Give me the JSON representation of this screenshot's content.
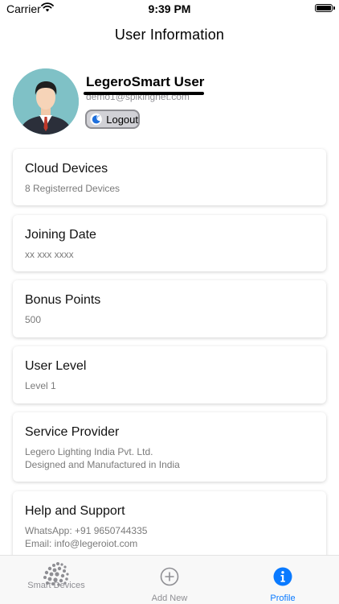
{
  "status_bar": {
    "carrier": "Carrier",
    "time": "9:39 PM"
  },
  "nav": {
    "title": "User Information"
  },
  "profile": {
    "name": "LegeroSmart User",
    "email": "demo1@spikingnet.com",
    "logout_label": "Logout"
  },
  "cards": [
    {
      "title": "Cloud Devices",
      "lines": [
        "8 Registerred Devices"
      ]
    },
    {
      "title": "Joining Date",
      "lines": [
        "xx xxx xxxx"
      ]
    },
    {
      "title": "Bonus Points",
      "lines": [
        "500"
      ]
    },
    {
      "title": "User Level",
      "lines": [
        "Level 1"
      ]
    },
    {
      "title": "Service Provider",
      "lines": [
        "Legero Lighting India Pvt. Ltd.",
        "Designed and Manufactured in India"
      ]
    },
    {
      "title": "Help and Support",
      "lines": [
        "WhatsApp: +91 9650744335",
        "Email: info@legeroiot.com"
      ]
    }
  ],
  "tabs": [
    {
      "label": "Smart Devices",
      "icon": "smart-devices-icon",
      "active": false
    },
    {
      "label": "Add New",
      "icon": "add-circle-icon",
      "active": false
    },
    {
      "label": "Profile",
      "icon": "info-icon",
      "active": true
    }
  ],
  "colors": {
    "accent": "#0a7aff",
    "inactive": "#8e8e93",
    "avatar_bg": "#7fc1c6"
  }
}
